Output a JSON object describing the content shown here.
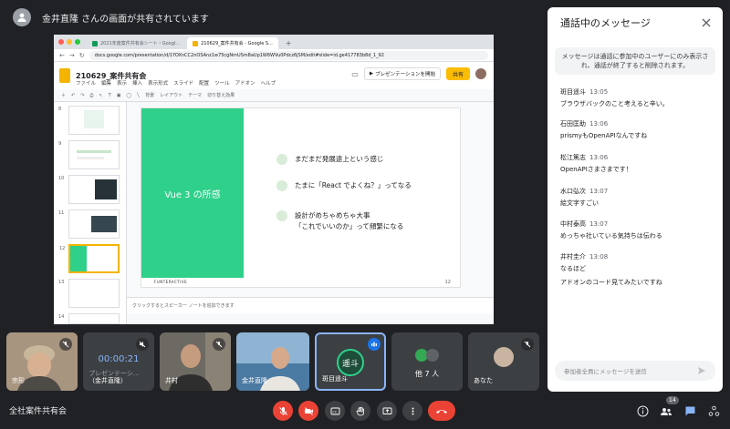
{
  "banner": {
    "presenting_text": "金井直隆 さんの画面が共有されています"
  },
  "shared_screen": {
    "tabs": [
      "2021年度案件共有会シート・Googl...",
      "210629_案件共有会 - Google S..."
    ],
    "url": "docs.google.com/presentation/d/1YOXnCC2nOSAnz1w75cgNmUSm8aUp1W6WVu0Pdcz6jSM/edit#slide=id.ge417783b8d_1_92",
    "doc_title": "210629_案件共有会",
    "menu": [
      "ファイル",
      "編集",
      "表示",
      "挿入",
      "表示形式",
      "スライド",
      "配置",
      "ツール",
      "アドオン",
      "ヘルプ"
    ],
    "present_button": "プレゼンテーションを開始",
    "share_button": "共有",
    "toolbar": [
      "背景",
      "レイアウト",
      "テーマ",
      "切り替え効果"
    ],
    "thumb_numbers": [
      "8",
      "9",
      "10",
      "11",
      "12",
      "13",
      "14"
    ],
    "slide": {
      "title": "Vue 3 の所感",
      "bullets": [
        {
          "lines": [
            "まだまだ発展途上という感じ"
          ]
        },
        {
          "lines": [
            "たまに「React でよくね？」ってなる"
          ]
        },
        {
          "lines": [
            "設計がめちゃめちゃ大事",
            "「これでいいのか」って頻繁になる"
          ]
        }
      ],
      "brand": "FUNTERACTIVE",
      "page": "12"
    },
    "notes_placeholder": "クリックするとスピーカー ノートを追加できます"
  },
  "panel": {
    "title": "通話中のメッセージ",
    "info": "メッセージは通話に参加中のユーザーにのみ表示され、通話が終了すると削除されます。",
    "messages": [
      {
        "sender": "斑目遥斗",
        "time": "13:05",
        "text": "ブラウザバックのこと考えると辛い。"
      },
      {
        "sender": "石田匡助",
        "time": "13:06",
        "text": "prismyもOpenAPIなんですね"
      },
      {
        "sender": "松江篤志",
        "time": "13:06",
        "text": "OpenAPIさまさまです！"
      },
      {
        "sender": "水口弘次",
        "time": "13:07",
        "text": "絵文字すごい"
      },
      {
        "sender": "中村泰高",
        "time": "13:07",
        "text": "めっちゃ社いている気持ちは伝わる"
      },
      {
        "sender": "井村圭介",
        "time": "13:08",
        "text": "なるほど"
      },
      {
        "sender": "",
        "time": "",
        "text": "アドオンのコード見てみたいですね"
      }
    ],
    "composer_placeholder": "参加者全員にメッセージを送信"
  },
  "participants": {
    "t1": "宗形",
    "t2_timer": "00:00:21",
    "t2_sub": "プレゼンテーシ...",
    "t2_name": "（金井直隆）",
    "t3": "井村",
    "t4": "金井直隆",
    "t5_avatar": "遥斗",
    "t5_name": "斑目遥斗",
    "t6": "他 7 人",
    "t7": "あなた"
  },
  "bottom": {
    "meeting_title": "全社案件共有会",
    "people_badge": "14"
  },
  "colors": {
    "bg": "#202124",
    "slide_green": "#2fd08a",
    "accent_blue": "#1a73e8",
    "end_red": "#ea4335",
    "share_yellow": "#fbbc04"
  }
}
